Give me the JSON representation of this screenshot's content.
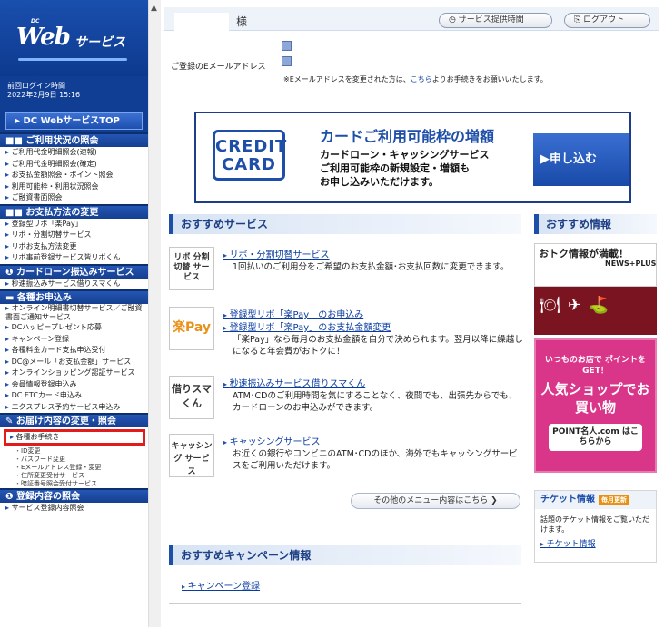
{
  "sidebar": {
    "logo_dc": "DC",
    "logo_web": "Web",
    "logo_service": "サービス",
    "login_label": "前回ログイン時間",
    "login_time": "2022年2月9日 15:16",
    "top_button": "▸ DC WebサービスTOP",
    "sections": [
      {
        "head": "■■ ご利用状況の照会",
        "items": [
          "ご利用代金明細照会(速報)",
          "ご利用代金明細照会(確定)",
          "お支払金額照会・ポイント照会",
          "利用可能枠・利用状況照会",
          "ご融資書面照会"
        ]
      },
      {
        "head": "■■ お支払方法の変更",
        "items": [
          "登録型リボ「楽Pay」",
          "リボ・分割切替サービス",
          "リボお支払方法変更",
          "リボ事前登録サービス皆リボくん"
        ]
      },
      {
        "head": "❶ カードローン振込みサービス",
        "items": [
          "秒速振込みサービス借りスマくん"
        ]
      },
      {
        "head": "▬ 各種お申込み",
        "items": [
          "オンライン明細書切替サービス／ご融資書面ご通知サービス",
          "DCハッピープレゼント応募",
          "キャンペーン登録",
          "各種料金カード支払申込受付",
          "DC@メール「お支払金額」サービス",
          "オンラインショッピング認証サービス",
          "会員情報登録申込み",
          "DC ETCカード申込み",
          "エクスプレス予約サービス申込み"
        ]
      },
      {
        "head": "✎ お届け内容の変更・照会",
        "items": [
          "各種お手続き"
        ],
        "subs": [
          "ID変更",
          "パスワード変更",
          "Eメールアドレス登録・変更",
          "住所変更受付サービス",
          "暗証番号照会受付サービス"
        ]
      },
      {
        "head": "❶ 登録内容の照会",
        "items": [
          "サービス登録内容照会"
        ]
      }
    ]
  },
  "header": {
    "honorific": "様",
    "service_time_button": "サービス提供時間",
    "logout_button": "ログアウト",
    "email_label": "ご登録のEメールアドレス",
    "email_note_pre": "※Eメールアドレスを変更された方は、",
    "email_note_link": "こちら",
    "email_note_post": "よりお手続きをお願いいたします。"
  },
  "banner": {
    "credit_line1": "CREDIT",
    "credit_line2": "CARD",
    "title": "カードご利用可能枠の増額",
    "line1": "カードローン・キャッシングサービス",
    "line2": "ご利用可能枠の新規設定・増額も",
    "line3": "お申し込みいただけます。",
    "apply": "▶申し込む"
  },
  "recommend": {
    "heading": "おすすめサービス",
    "services": [
      {
        "icon": "リボ 分割 切替 サービス",
        "links": [
          "リボ・分割切替サービス"
        ],
        "desc": "1回払いのご利用分をご希望のお支払金額･お支払回数に変更できます。"
      },
      {
        "icon": "楽Pay",
        "links": [
          "登録型リボ「楽Pay」のお申込み",
          "登録型リボ「楽Pay」のお支払金額変更"
        ],
        "desc": "「楽Pay」なら毎月のお支払金額を自分で決められます。翌月以降に繰越しになると年会費がおトクに！"
      },
      {
        "icon": "借りスマくん",
        "links": [
          "秒速振込みサービス借りスマくん"
        ],
        "desc": "ATM･CDのご利用時間を気にすることなく、夜間でも、出張先からでも、カードローンのお申込みができます。"
      },
      {
        "icon": "キャッシング サービス",
        "links": [
          "キャッシングサービス"
        ],
        "desc": "お近くの銀行やコンビニのATM･CDのほか、海外でもキャッシングサービスをご利用いただけます。"
      }
    ],
    "more_button": "その他のメニュー内容はこちら ❯"
  },
  "campaign": {
    "heading": "おすすめキャンペーン情報",
    "link": "キャンペーン登録"
  },
  "info": {
    "heading": "おすすめ情報",
    "ad1_title": "おトク情報が満載！",
    "ad1_sub": "NEWS+PLUS",
    "ad2_line1": "いつものお店で ポイントをGET！",
    "ad2_line2": "人気ショップでお買い物",
    "ad2_line3": "POINT名人.com はこちらから",
    "ticket_heading": "チケット情報",
    "ticket_tag": "毎月更新",
    "ticket_text": "話題のチケット情報をご覧いただけます。",
    "ticket_link": "チケット情報"
  }
}
